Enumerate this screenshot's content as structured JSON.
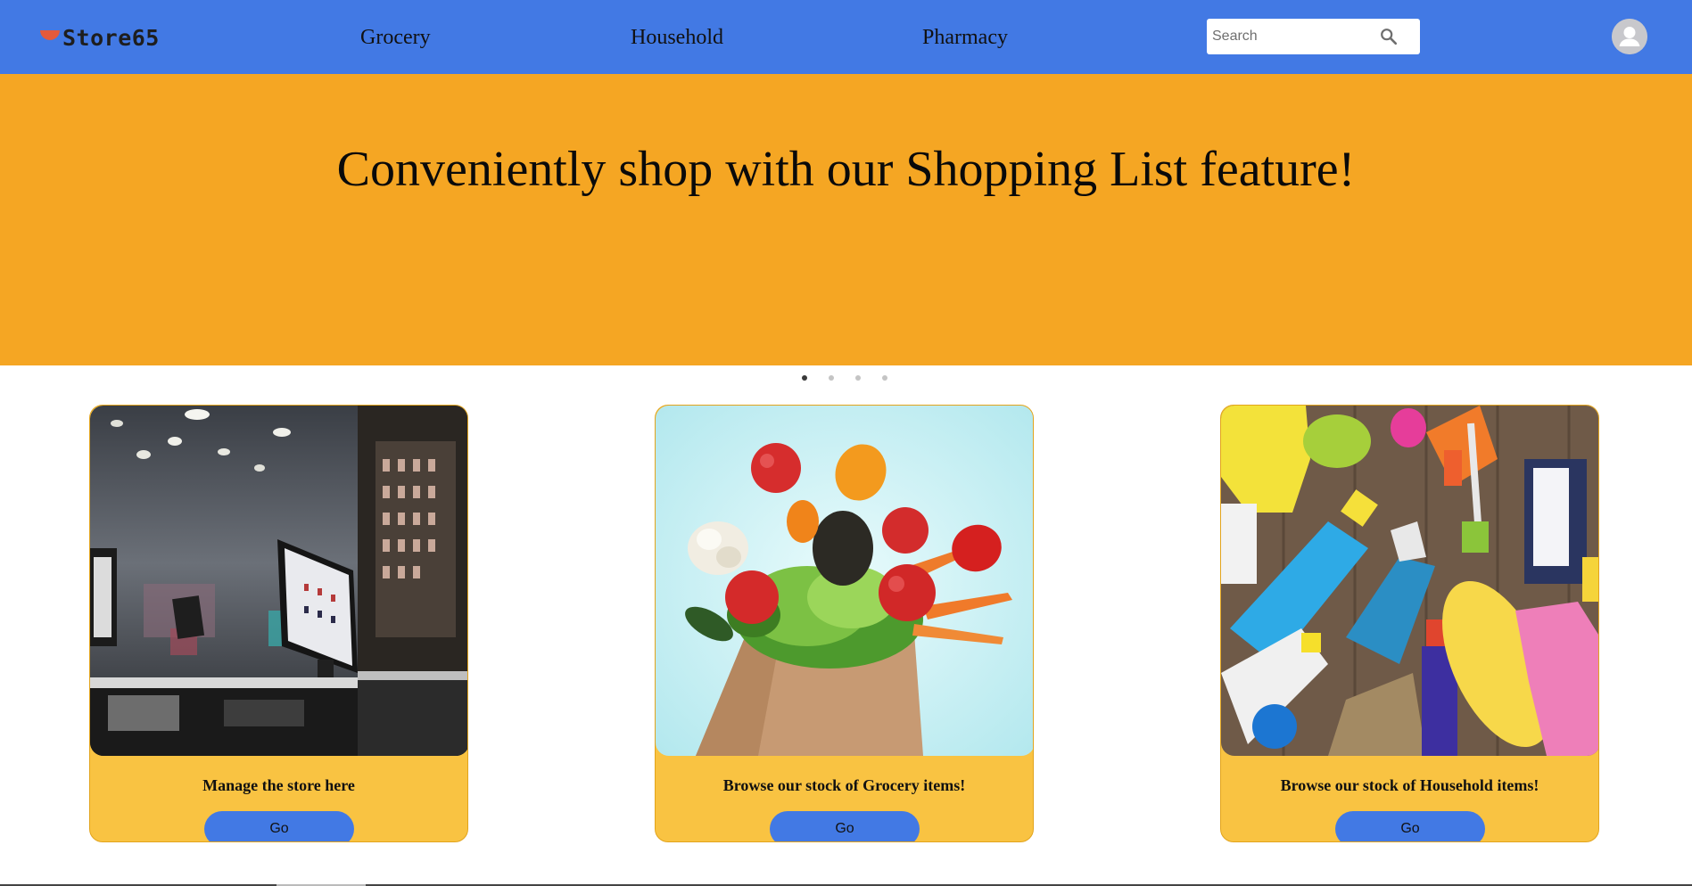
{
  "brand": {
    "name": "Store65",
    "primary_color": "#4279e4",
    "hero_color": "#f5a623",
    "card_color": "#f9c342",
    "logo_mark_color": "#e55a3c"
  },
  "nav": {
    "links": [
      {
        "label": "Grocery"
      },
      {
        "label": "Household"
      },
      {
        "label": "Pharmacy"
      }
    ],
    "search": {
      "placeholder": "Search",
      "value": "",
      "icon": "search-icon"
    },
    "avatar_icon": "user-avatar-icon"
  },
  "hero": {
    "title": "Conveniently shop with our Shopping List feature!",
    "slides": 4,
    "active_slide": 1
  },
  "cards": [
    {
      "title": "Manage the store here",
      "button_label": "Go",
      "image": "store-checkout-image"
    },
    {
      "title": "Browse our stock of Grocery items!",
      "button_label": "Go",
      "image": "grocery-bag-image"
    },
    {
      "title": "Browse our stock of Household items!",
      "button_label": "Go",
      "image": "cleaning-supplies-image"
    }
  ]
}
